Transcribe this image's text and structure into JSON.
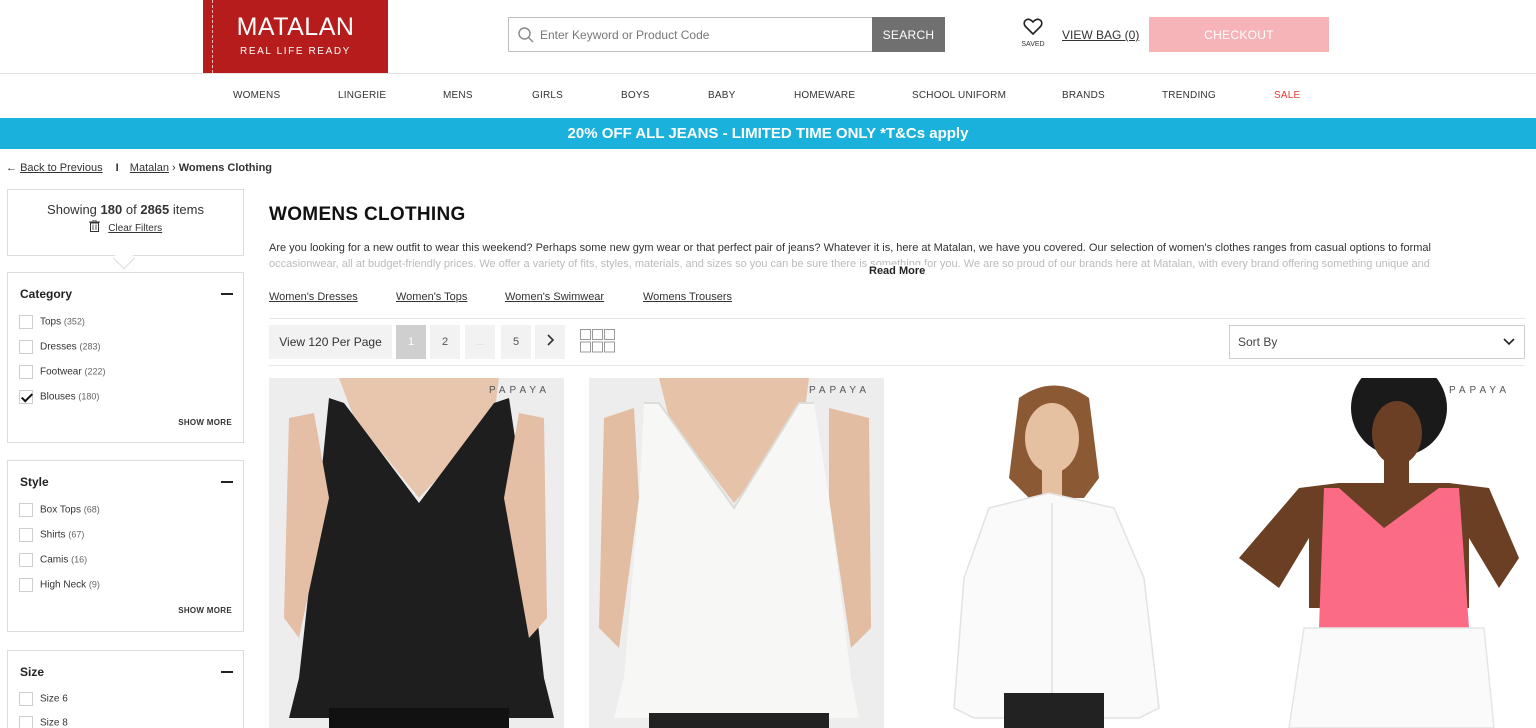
{
  "header": {
    "logo": {
      "brand": "MATALAN",
      "tagline": "REAL LIFE READY"
    },
    "search": {
      "placeholder": "Enter Keyword or Product Code",
      "button": "SEARCH"
    },
    "saved_label": "SAVED",
    "view_bag": "VIEW BAG (0)",
    "checkout": "CHECKOUT"
  },
  "nav": [
    "WOMENS",
    "LINGERIE",
    "MENS",
    "GIRLS",
    "BOYS",
    "BABY",
    "HOMEWARE",
    "SCHOOL UNIFORM",
    "BRANDS",
    "TRENDING",
    "SALE"
  ],
  "promo": "20% OFF ALL JEANS - LIMITED TIME ONLY *T&Cs apply",
  "breadcrumb": {
    "back": "Back to Previous",
    "separator": "I",
    "home": "Matalan",
    "current": "Womens Clothing"
  },
  "summary": {
    "showing_prefix": "Showing",
    "shown": "180",
    "of": "of",
    "total": "2865",
    "items": "items",
    "clear": "Clear Filters"
  },
  "filters": {
    "category": {
      "title": "Category",
      "options": [
        {
          "label": "Tops",
          "count": "(352)",
          "checked": false
        },
        {
          "label": "Dresses",
          "count": "(283)",
          "checked": false
        },
        {
          "label": "Footwear",
          "count": "(222)",
          "checked": false
        },
        {
          "label": "Blouses",
          "count": "(180)",
          "checked": true
        }
      ],
      "more": "SHOW MORE"
    },
    "style": {
      "title": "Style",
      "options": [
        {
          "label": "Box Tops",
          "count": "(68)",
          "checked": false
        },
        {
          "label": "Shirts",
          "count": "(67)",
          "checked": false
        },
        {
          "label": "Camis",
          "count": "(16)",
          "checked": false
        },
        {
          "label": "High Neck",
          "count": "(9)",
          "checked": false
        }
      ],
      "more": "SHOW MORE"
    },
    "size": {
      "title": "Size",
      "options": [
        {
          "label": "Size 6",
          "checked": false
        },
        {
          "label": "Size 8",
          "checked": false
        }
      ]
    }
  },
  "main": {
    "title": "WOMENS CLOTHING",
    "description": "Are you looking for a new outfit to wear this weekend? Perhaps some new gym wear or that perfect pair of jeans? Whatever it is, here at Matalan, we have you covered. Our selection of women's clothes ranges from casual options to formal",
    "description_faded": "occasionwear, all at budget-friendly prices. We offer a variety of fits, styles, materials, and sizes so you can be sure there is something for you. We are so proud of our brands here at Matalan, with every brand offering something unique and",
    "read_more": "Read More",
    "sublinks": [
      "Women's Dresses",
      "Women's Tops",
      "Women's Swimwear",
      "Womens Trousers"
    ],
    "per_page": "View 120 Per Page",
    "pages": [
      "1",
      "2",
      "...",
      "5"
    ],
    "current_page": "1",
    "sort_by": "Sort By"
  },
  "products": [
    {
      "brand": "PAPAYA",
      "image": "black v-neck cami top"
    },
    {
      "brand": "PAPAYA",
      "image": "white v-neck cami top"
    },
    {
      "brand": "",
      "image": "white button-up shirt"
    },
    {
      "brand": "PAPAYA",
      "image": "pink cami top"
    }
  ],
  "colors": {
    "brand_red": "#b71c1c",
    "promo_blue": "#1ab2dc",
    "checkout_pink": "#f7b4b8",
    "sale_red": "#e53935",
    "search_btn": "#707070"
  }
}
